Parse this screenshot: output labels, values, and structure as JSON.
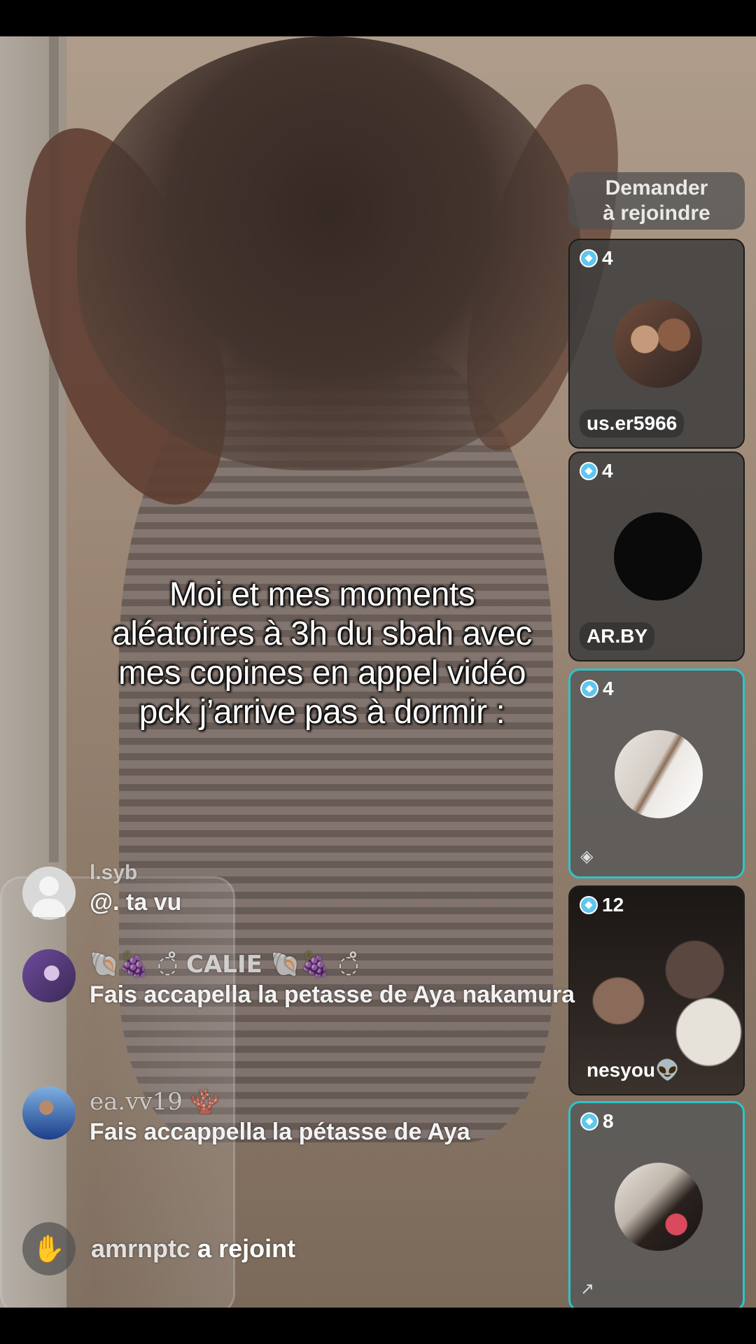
{
  "caption": "Moi et mes moments aléatoires à 3h du sbah avec mes copines en appel vidéo pck j’arrive pas à dormir :",
  "join_button": {
    "line1": "Demander",
    "line2": "à rejoindre"
  },
  "guests": [
    {
      "count": "4",
      "name": "us.er5966",
      "avatar": "couple-photo-avatar"
    },
    {
      "count": "4",
      "name": "AR.BY",
      "avatar": "black-circle-avatar"
    },
    {
      "count": "4",
      "name": "",
      "avatar": "room-photo-avatar",
      "active": true
    },
    {
      "count": "12",
      "name": "nesyou👽",
      "avatar": "live-video-feed"
    },
    {
      "count": "8",
      "name": "",
      "avatar": "hair-photo-avatar",
      "active": true
    }
  ],
  "comments": [
    {
      "user": "l.syb",
      "message": "@. ta vu"
    },
    {
      "user": "🐚🍇 ◌̊ CALIE 🐚🍇 ◌̊",
      "message": "Fais accapella la petasse de Aya nakamura"
    },
    {
      "user": "ea.vv19 🪸",
      "message": "Fais accappella la pétasse de Aya"
    }
  ],
  "join_notice": {
    "user": "amrnptc",
    "action": "a rejoint"
  },
  "colors": {
    "active_border": "#2ec4c9",
    "gem": "#5fc6ee"
  }
}
